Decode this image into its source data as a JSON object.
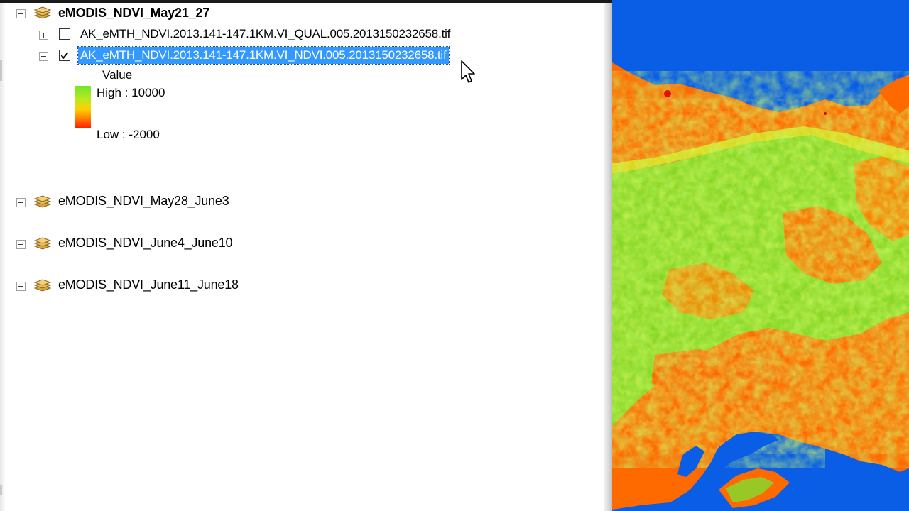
{
  "toc": {
    "groups": [
      {
        "name": "eMODIS_NDVI_May21_27",
        "expanded": true,
        "layers": [
          {
            "name": "AK_eMTH_NDVI.2013.141-147.1KM.VI_QUAL.005.2013150232658.tif",
            "checked": false,
            "expanded": false
          },
          {
            "name": "AK_eMTH_NDVI.2013.141-147.1KM.VI_NDVI.005.2013150232658.tif",
            "checked": true,
            "expanded": true,
            "selected": true,
            "legend": {
              "heading": "Value",
              "high": "High : 10000",
              "low": "Low : -2000"
            }
          }
        ]
      },
      {
        "name": "eMODIS_NDVI_May28_June3",
        "expanded": false
      },
      {
        "name": "eMODIS_NDVI_June4_June10",
        "expanded": false
      },
      {
        "name": "eMODIS_NDVI_June11_June18",
        "expanded": false
      }
    ]
  },
  "colors": {
    "selection": "#3399ff",
    "water": "#0a5ee6",
    "ndvi_high": "#6fe62a",
    "ndvi_mid": "#ffd000",
    "ndvi_low": "#ff1a00",
    "land_low": "#ff6a00"
  },
  "icons": {
    "group": "layer-group-icon",
    "expand": "plus-expander-icon",
    "collapse": "minus-expander-icon",
    "check": "checkmark-icon",
    "cursor": "mouse-pointer-icon"
  }
}
